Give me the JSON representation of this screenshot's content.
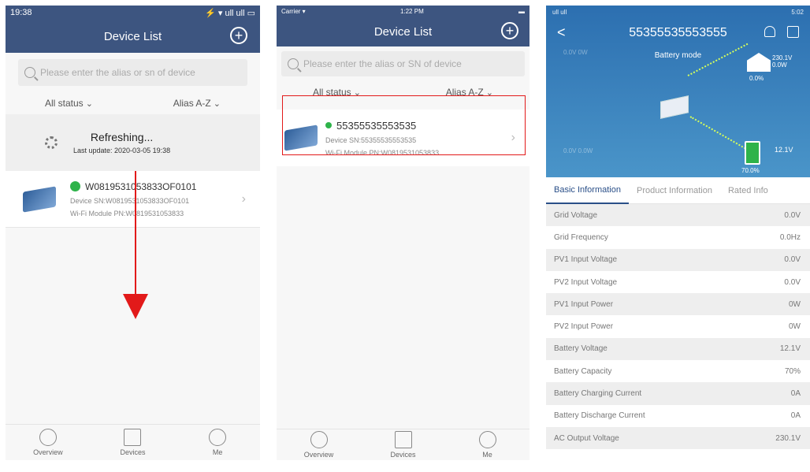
{
  "panel1": {
    "status_time": "19:38",
    "status_icons": "⚡ ▾ ull ull ▭",
    "title": "Device List",
    "add_icon": "+",
    "search_placeholder": "Please enter the alias or sn of device",
    "filter_status": "All status",
    "filter_sort": "Alias A-Z",
    "refresh_title": "Refreshing...",
    "refresh_sub": "Last update: 2020-03-05 19:38",
    "device": {
      "name": "W0819531053833OF0101",
      "sn": "Device SN:W0819531053833OF0101",
      "pn": "Wi-Fi Module PN:W0819531053833"
    },
    "tabs": [
      "Overview",
      "Devices",
      "Me"
    ]
  },
  "panel2": {
    "status_carrier": "Carrier ▾",
    "status_time": "1:22 PM",
    "title": "Device List",
    "add_icon": "+",
    "search_placeholder": "Please enter the alias or SN of device",
    "filter_status": "All status",
    "filter_sort": "Alias A-Z",
    "device": {
      "name": "55355535553535",
      "sn": "Device SN:55355535553535",
      "pn": "Wi-Fi Module PN:W0819531053833"
    },
    "tabs": [
      "Overview",
      "Devices",
      "Me"
    ]
  },
  "panel3": {
    "status_left": "ull ull",
    "status_right": "5:02",
    "back_icon": "<",
    "title": "55355535553555",
    "mode": "Battery mode",
    "home_volts": "230.1V",
    "home_watts": "0.0W",
    "home_pct": "0.0%",
    "battery_volts": "12.1V",
    "battery_pct": "70.0%",
    "pv_top": "0.0V 0W",
    "pv_bottom": "0.0V 0.0W",
    "tabs": [
      "Basic Information",
      "Product Information",
      "Rated Info"
    ],
    "rows": [
      {
        "label": "Grid Voltage",
        "value": "0.0V"
      },
      {
        "label": "Grid Frequency",
        "value": "0.0Hz"
      },
      {
        "label": "PV1 Input Voltage",
        "value": "0.0V"
      },
      {
        "label": "PV2 Input Voltage",
        "value": "0.0V"
      },
      {
        "label": "PV1 Input Power",
        "value": "0W"
      },
      {
        "label": "PV2 Input Power",
        "value": "0W"
      },
      {
        "label": "Battery Voltage",
        "value": "12.1V"
      },
      {
        "label": "Battery Capacity",
        "value": "70%"
      },
      {
        "label": "Battery Charging Current",
        "value": "0A"
      },
      {
        "label": "Battery Discharge Current",
        "value": "0A"
      },
      {
        "label": "AC Output Voltage",
        "value": "230.1V"
      }
    ]
  },
  "colors": {
    "header": "#3d5580",
    "highlight": "#e21a1a",
    "online": "#2eb34a",
    "hero": "#2c6fb0"
  }
}
